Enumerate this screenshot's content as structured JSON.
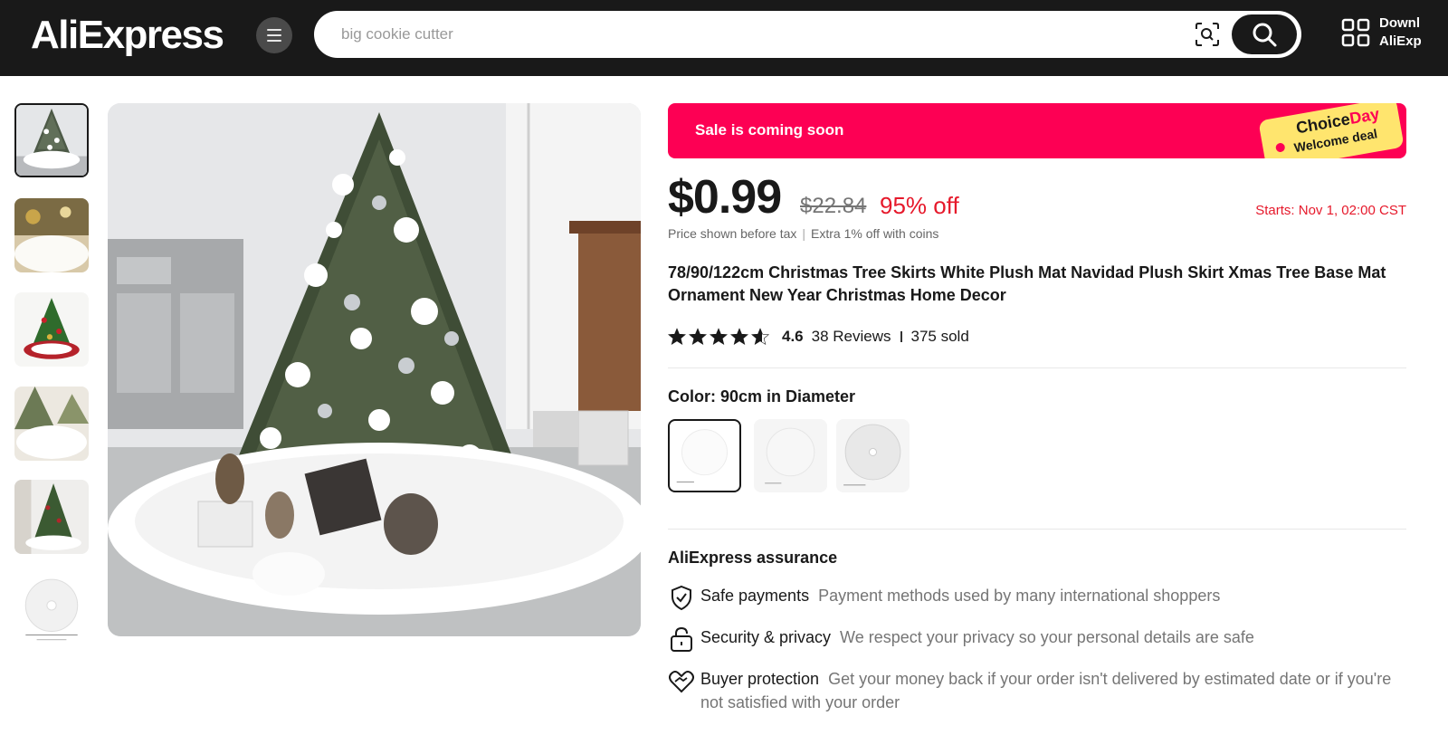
{
  "header": {
    "logo_text": "AliExpress",
    "search_placeholder": "big cookie cutter",
    "download_line1": "Downl",
    "download_line2": "AliExp"
  },
  "promo": {
    "sale_text": "Sale is coming soon",
    "badge_word1": "Choice",
    "badge_word2": "Day",
    "badge_line2": "Welcome deal"
  },
  "pricing": {
    "price": "$0.99",
    "original_price": "$22.84",
    "discount": "95% off",
    "starts": "Starts:  Nov 1, 02:00 CST",
    "tax_note": "Price shown before tax",
    "coins_note": "Extra 1% off with coins"
  },
  "product": {
    "title": "78/90/122cm Christmas Tree Skirts White Plush Mat Navidad Plush Skirt Xmas Tree Base Mat Ornament New Year Christmas Home Decor",
    "rating_score": "4.6",
    "rating_stars": 4.6,
    "reviews": "38 Reviews",
    "sold": "375 sold",
    "color_label": "Color: 90cm in Diameter",
    "swatch_count": 3,
    "selected_swatch": 0
  },
  "assurance": {
    "title": "AliExpress assurance",
    "items": [
      {
        "icon": "shield-check-icon",
        "head": "Safe payments",
        "desc": "Payment methods used by many international shoppers"
      },
      {
        "icon": "lock-icon",
        "head": "Security & privacy",
        "desc": "We respect your privacy so your personal details are safe"
      },
      {
        "icon": "handshake-heart-icon",
        "head": "Buyer protection",
        "desc": "Get your money back if your order isn't delivered by estimated date or if you're not satisfied with your order"
      }
    ]
  },
  "colors": {
    "header_bg": "#191919",
    "sale_red": "#fd0054",
    "discount_red": "#e6192b",
    "badge_yellow": "#ffe56e"
  }
}
